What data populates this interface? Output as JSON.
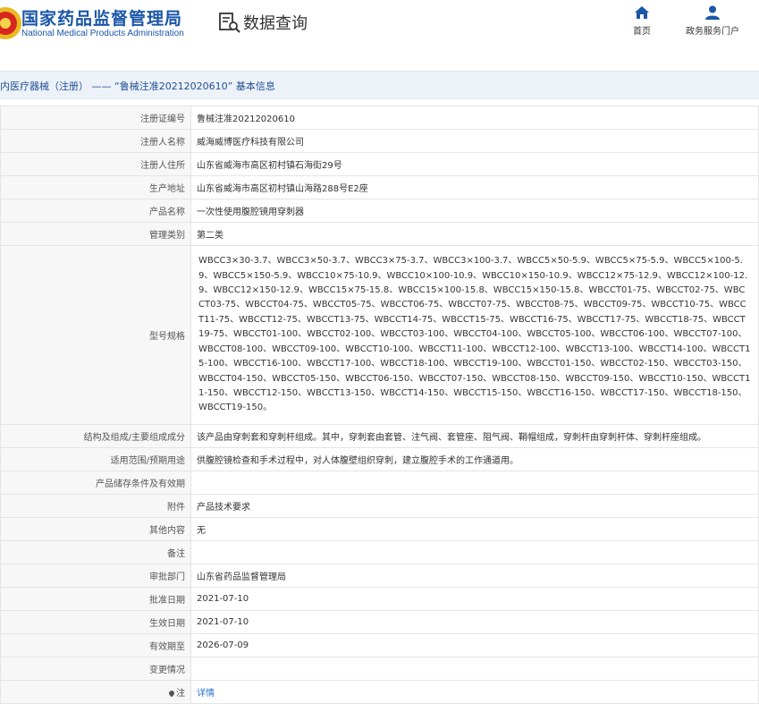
{
  "header": {
    "site_name_cn": "国家药品监督管理局",
    "site_name_en": "National Medical Products Administration",
    "section_title": "数据查询",
    "nav": [
      {
        "label": "首页",
        "icon": "home-icon"
      },
      {
        "label": "政务服务门户",
        "icon": "user-icon"
      }
    ]
  },
  "breadcrumb": "内医疗器械（注册） —— “鲁械注准20212020610” 基本信息",
  "fields": [
    {
      "label": "注册证编号",
      "value": "鲁械注准20212020610"
    },
    {
      "label": "注册人名称",
      "value": "威海威博医疗科技有限公司"
    },
    {
      "label": "注册人住所",
      "value": "山东省威海市高区初村镇石海街29号"
    },
    {
      "label": "生产地址",
      "value": "山东省威海市高区初村镇山海路288号E2座"
    },
    {
      "label": "产品名称",
      "value": "一次性使用腹腔镜用穿刺器"
    },
    {
      "label": "管理类别",
      "value": "第二类"
    },
    {
      "label": "型号规格",
      "value": "WBCC3×30-3.7、WBCC3×50-3.7、WBCC3×75-3.7、WBCC3×100-3.7、WBCC5×50-5.9、WBCC5×75-5.9、WBCC5×100-5.9、WBCC5×150-5.9、WBCC10×75-10.9、WBCC10×100-10.9、WBCC10×150-10.9、WBCC12×75-12.9、WBCC12×100-12.9、WBCC12×150-12.9、WBCC15×75-15.8、WBCC15×100-15.8、WBCC15×150-15.8、WBCCT01-75、WBCCT02-75、WBCCT03-75、WBCCT04-75、WBCCT05-75、WBCCT06-75、WBCCT07-75、WBCCT08-75、WBCCT09-75、WBCCT10-75、WBCCT11-75、WBCCT12-75、WBCCT13-75、WBCCT14-75、WBCCT15-75、WBCCT16-75、WBCCT17-75、WBCCT18-75、WBCCT19-75、WBCCT01-100、WBCCT02-100、WBCCT03-100、WBCCT04-100、WBCCT05-100、WBCCT06-100、WBCCT07-100、WBCCT08-100、WBCCT09-100、WBCCT10-100、WBCCT11-100、WBCCT12-100、WBCCT13-100、WBCCT14-100、WBCCT15-100、WBCCT16-100、WBCCT17-100、WBCCT18-100、WBCCT19-100、WBCCT01-150、WBCCT02-150、WBCCT03-150、WBCCT04-150、WBCCT05-150、WBCCT06-150、WBCCT07-150、WBCCT08-150、WBCCT09-150、WBCCT10-150、WBCCT11-150、WBCCT12-150、WBCCT13-150、WBCCT14-150、WBCCT15-150、WBCCT16-150、WBCCT17-150、WBCCT18-150、WBCCT19-150。"
    },
    {
      "label": "结构及组成/主要组成成分",
      "value": "该产品由穿刺套和穿刺杆组成。其中，穿刺套由套管、注气阀、套管座、阻气阀、鞘帽组成，穿刺杆由穿刺杆体、穿刺杆座组成。"
    },
    {
      "label": "适用范围/预期用途",
      "value": "供腹腔镜检查和手术过程中，对人体腹壁组织穿刺，建立腹腔手术的工作通道用。"
    },
    {
      "label": "产品储存条件及有效期",
      "value": ""
    },
    {
      "label": "附件",
      "value": "产品技术要求"
    },
    {
      "label": "其他内容",
      "value": "无"
    },
    {
      "label": "备注",
      "value": ""
    },
    {
      "label": "审批部门",
      "value": "山东省药品监督管理局"
    },
    {
      "label": "批准日期",
      "value": "2021-07-10"
    },
    {
      "label": "生效日期",
      "value": "2021-07-10"
    },
    {
      "label": "有效期至",
      "value": "2026-07-09"
    },
    {
      "label": "变更情况",
      "value": ""
    },
    {
      "label": "注",
      "value": "详情"
    }
  ],
  "colors": {
    "brand": "#1a56a8",
    "link": "#2a72c8",
    "bar_bg": "#edf2f8"
  }
}
